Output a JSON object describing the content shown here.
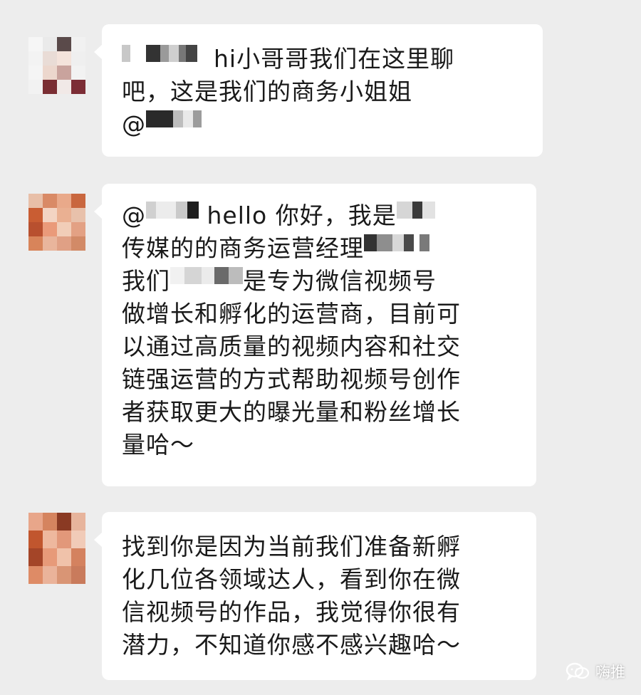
{
  "messages": [
    {
      "mention": "",
      "line1": "hi小哥哥我们在这里聊",
      "line2": "吧，这是我们的商务小姐姐",
      "line3": "@"
    },
    {
      "mention": "@",
      "part1": "hello 你好，我是",
      "line2": "传媒的的商务运营经理",
      "line3a": "我们",
      "line3b": "是专为微信视频号",
      "line4": "做增长和孵化的运营商，目前可",
      "line5": "以通过高质量的视频内容和社交",
      "line6": "链强运营的方式帮助视频号创作",
      "line7": "者获取更大的曝光量和粉丝增长",
      "line8": "量哈～"
    },
    {
      "line1": "找到你是因为当前我们准备新孵",
      "line2": "化几位各领域达人，看到你在微",
      "line3": "信视频号的作品，我觉得你很有",
      "line4": "潜力，不知道你感不感兴趣哈～"
    }
  ],
  "watermark": {
    "label": "嗨推",
    "icon": "wechat-icon"
  }
}
